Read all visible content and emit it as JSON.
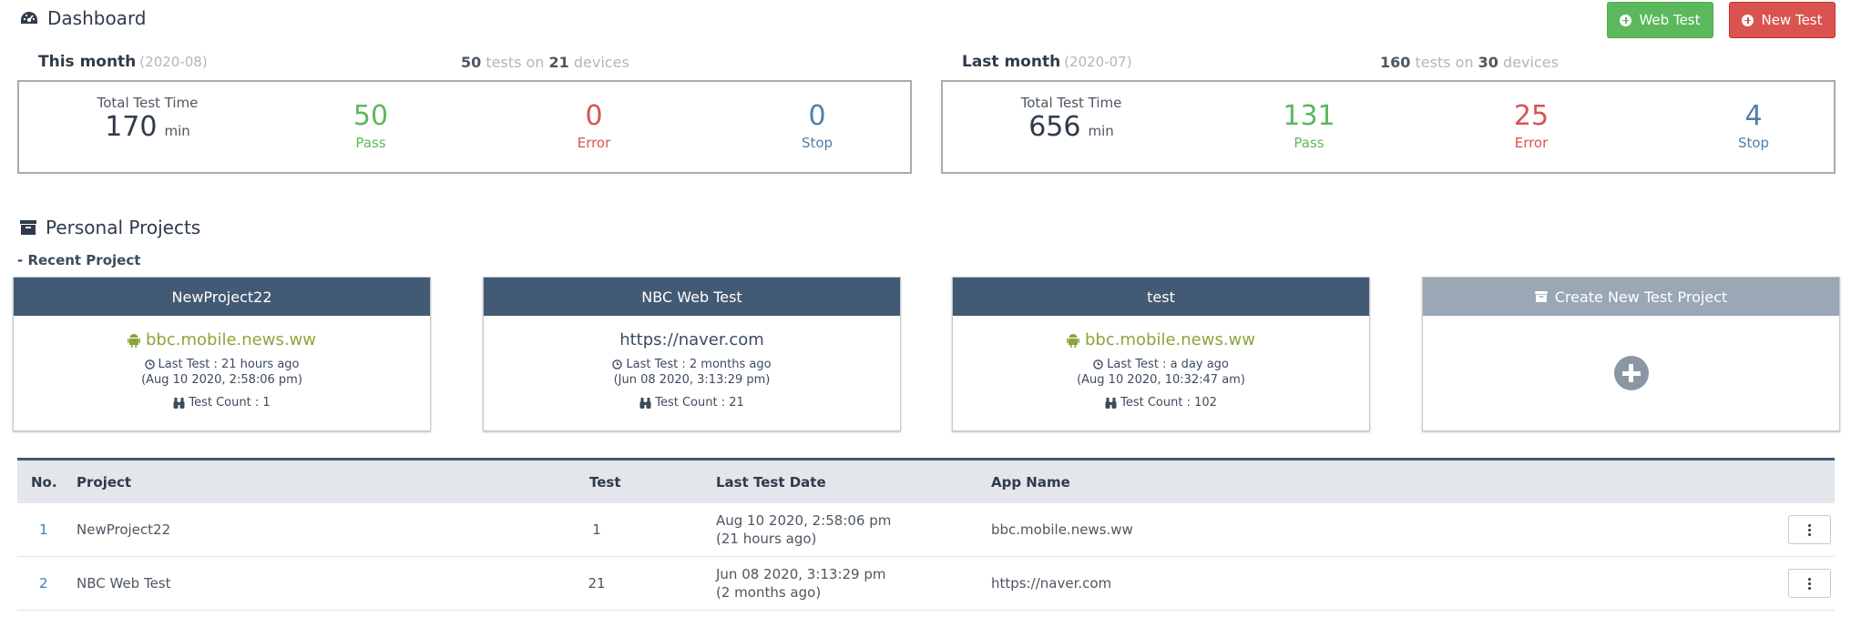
{
  "header": {
    "title": "Dashboard",
    "web_test_label": "Web Test",
    "new_test_label": "New Test"
  },
  "this_month": {
    "label": "This month",
    "period": "(2020-08)",
    "tests": "50",
    "devices": "21",
    "tests_word": "tests on",
    "devices_word": "devices",
    "total_label": "Total Test Time",
    "total_value": "170",
    "total_unit": "min",
    "pass_value": "50",
    "pass_label": "Pass",
    "error_value": "0",
    "error_label": "Error",
    "stop_value": "0",
    "stop_label": "Stop"
  },
  "last_month": {
    "label": "Last month",
    "period": "(2020-07)",
    "tests": "160",
    "devices": "30",
    "tests_word": "tests on",
    "devices_word": "devices",
    "total_label": "Total Test Time",
    "total_value": "656",
    "total_unit": "min",
    "pass_value": "131",
    "pass_label": "Pass",
    "error_value": "25",
    "error_label": "Error",
    "stop_value": "4",
    "stop_label": "Stop"
  },
  "personal": {
    "title": "Personal Projects",
    "recent_label": "- Recent Project",
    "cards": [
      {
        "name": "NewProject22",
        "app": "bbc.mobile.news.ww",
        "last_test": "Last Test : 21 hours ago",
        "last_date": "(Aug 10 2020, 2:58:06 pm)",
        "count": "Test Count : 1"
      },
      {
        "name": "NBC Web Test",
        "app": "https://naver.com",
        "last_test": "Last Test : 2 months ago",
        "last_date": "(Jun 08 2020, 3:13:29 pm)",
        "count": "Test Count : 21"
      },
      {
        "name": "test",
        "app": "bbc.mobile.news.ww",
        "last_test": "Last Test : a day ago",
        "last_date": "(Aug 10 2020, 10:32:47 am)",
        "count": "Test Count : 102"
      }
    ],
    "create_label": "Create New Test Project"
  },
  "table": {
    "headers": {
      "no": "No.",
      "project": "Project",
      "test": "Test",
      "date": "Last Test Date",
      "app": "App Name"
    },
    "rows": [
      {
        "no": "1",
        "project": "NewProject22",
        "test": "1",
        "date": "Aug 10 2020, 2:58:06 pm",
        "ago": "(21 hours ago)",
        "app": "bbc.mobile.news.ww"
      },
      {
        "no": "2",
        "project": "NBC Web Test",
        "test": "21",
        "date": "Jun 08 2020, 3:13:29 pm",
        "ago": "(2 months ago)",
        "app": "https://naver.com"
      }
    ]
  },
  "colors": {
    "accent": "#435a74",
    "pass": "#5cb85c",
    "error": "#d9534f",
    "stop": "#4e80ab",
    "android": "#8aa63a"
  },
  "icons": {
    "dashboard": "dashboard-gauge-icon",
    "projects": "archive-box-icon",
    "android": "android-icon",
    "clock": "clock-icon",
    "binoculars": "binoculars-icon",
    "plus": "plus-circle-icon",
    "menu": "kebab-menu-icon"
  }
}
